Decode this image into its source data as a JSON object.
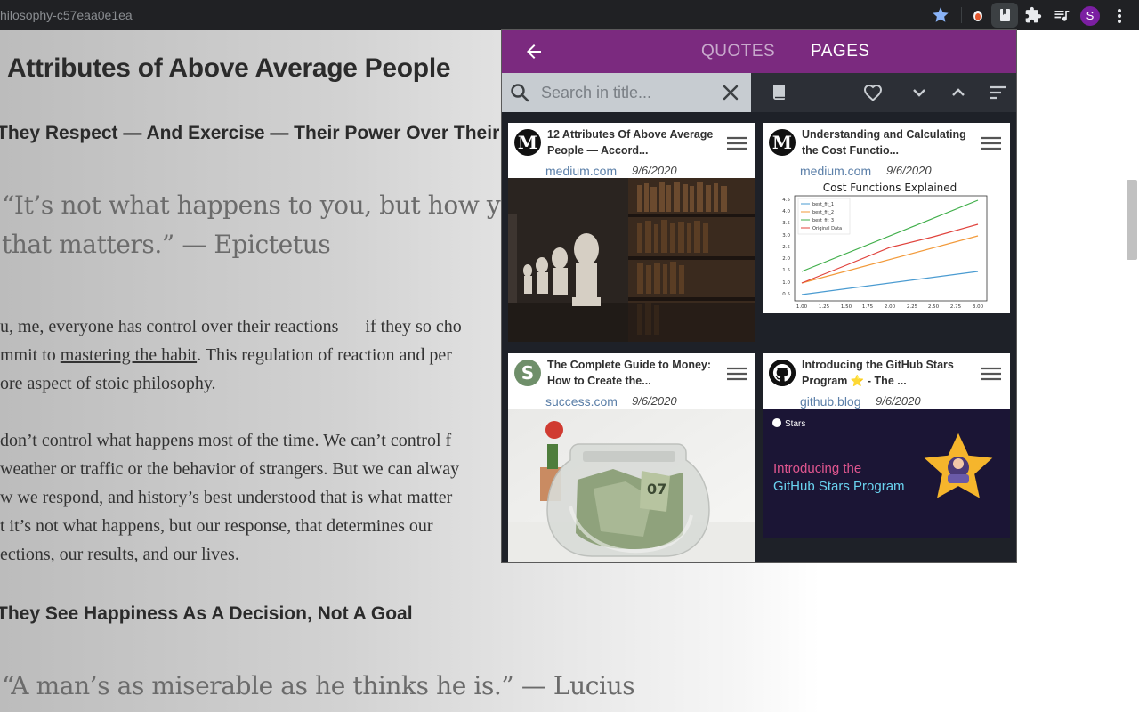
{
  "browser": {
    "url_fragment": "hilosophy-c57eaa0e1ea",
    "avatar_letter": "S",
    "accent_color": "#7b1fa2"
  },
  "article": {
    "heading": "Attributes of Above Average People",
    "section1_heading": "They Respect — And Exercise — Their Power Over Their Re",
    "quote1_line1": "“It’s not what happens to you, but how you rea",
    "quote1_line2": "that matters.” — Epictetus",
    "para1_line1": "u, me, everyone has control over their reactions — if they so cho",
    "para1_line2_pre": "mmit to ",
    "para1_line2_link": "mastering the habit",
    "para1_line2_post": ". This regulation of reaction and per",
    "para1_line3": "ore aspect of stoic philosophy.",
    "para2_line1": " don’t control what happens most of the time. We can’t control f",
    "para2_line2": "weather or traffic or the behavior of strangers. But we can alway",
    "para2_line3": "w we respond, and history’s best understood that is what matter",
    "para2_line4": "t it’s not what happens, but our response, that determines our",
    "para2_line5": "ections, our results, and our lives.",
    "section2_heading": "They See Happiness As A Decision, Not A Goal",
    "quote2": "“A man’s as miserable as he thinks he is.” — Lucius"
  },
  "popup": {
    "header_color": "#7b2a7f",
    "tabs": [
      {
        "label": "QUOTES",
        "active": false
      },
      {
        "label": "PAGES",
        "active": true
      }
    ],
    "search": {
      "placeholder": "Search in title...",
      "value": ""
    },
    "toolbar_icons": [
      "book-icon",
      "heart-icon",
      "chevron-down-icon",
      "chevron-up-icon",
      "sort-icon"
    ],
    "cards": [
      {
        "title": "12 Attributes Of Above Average People — Accord...",
        "domain": "medium.com",
        "date": "9/6/2020",
        "logo_letter": "M",
        "image": "library-busts-image"
      },
      {
        "title": "Understanding and Calculating the Cost Functio...",
        "domain": "medium.com",
        "date": "9/6/2020",
        "logo_letter": "M",
        "image": "cost-functions-chart-image",
        "image_text": {
          "chart_title": "Cost Functions Explained",
          "legend": [
            "best_fit_1",
            "best_fit_2",
            "best_fit_3",
            "Original Data"
          ],
          "y_ticks": [
            "4.5",
            "4.0",
            "3.5",
            "3.0",
            "2.5",
            "2.0",
            "1.5",
            "1.0",
            "0.5"
          ],
          "x_ticks": [
            "1.00",
            "1.25",
            "1.50",
            "1.75",
            "2.00",
            "2.25",
            "2.50",
            "2.75",
            "3.00"
          ]
        }
      },
      {
        "title": "The Complete Guide to Money: How to Create the...",
        "domain": "success.com",
        "date": "9/6/2020",
        "logo_letter": "S",
        "image": "money-jar-image",
        "image_text": {
          "bill_number": "07"
        }
      },
      {
        "title": "Introducing the GitHub Stars Program ⭐ - The ...",
        "domain": "github.blog",
        "date": "9/6/2020",
        "logo_letter": "",
        "image": "github-stars-banner-image",
        "image_text": {
          "badge": "Stars",
          "banner_line1": "Introducing the",
          "banner_line2": "GitHub Stars Program"
        }
      }
    ]
  }
}
